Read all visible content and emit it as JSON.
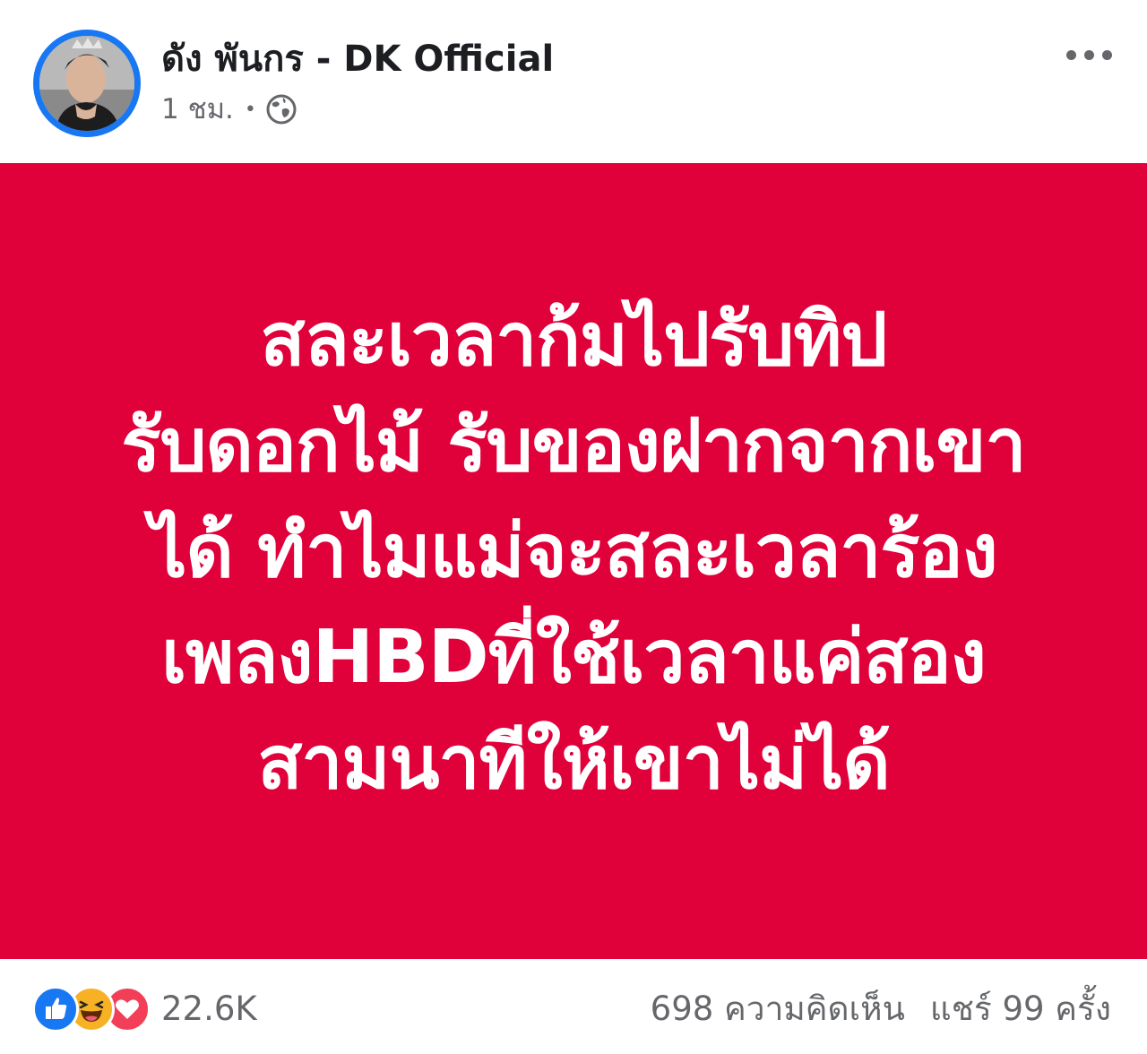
{
  "post": {
    "author": "ดัง พันกร - DK Official",
    "time": "1 ชม.",
    "separator": "•",
    "privacy_icon": "globe-icon",
    "more_icon": "more-options-icon",
    "background_color": "#e0003a",
    "text_color": "#ffffff",
    "text_lines": [
      "สละเวลาก้มไปรับทิป",
      "รับดอกไม้ รับของฝากจากเขา",
      "ได้ ทำไมแม่จะสละเวลาร้อง",
      "เพลงHBDที่ใช้เวลาแค่สอง",
      "สามนาทีให้เขาไม่ได้"
    ]
  },
  "engagement": {
    "reaction_icons": [
      "like-icon",
      "haha-icon",
      "love-icon"
    ],
    "reaction_count": "22.6K",
    "comments": "698 ความคิดเห็น",
    "shares": "แชร์ 99 ครั้ง"
  },
  "colors": {
    "brand_blue": "#1877f2",
    "muted_text": "#65676b",
    "haha_yellow": "#f7b125",
    "love_red": "#f33e58"
  }
}
